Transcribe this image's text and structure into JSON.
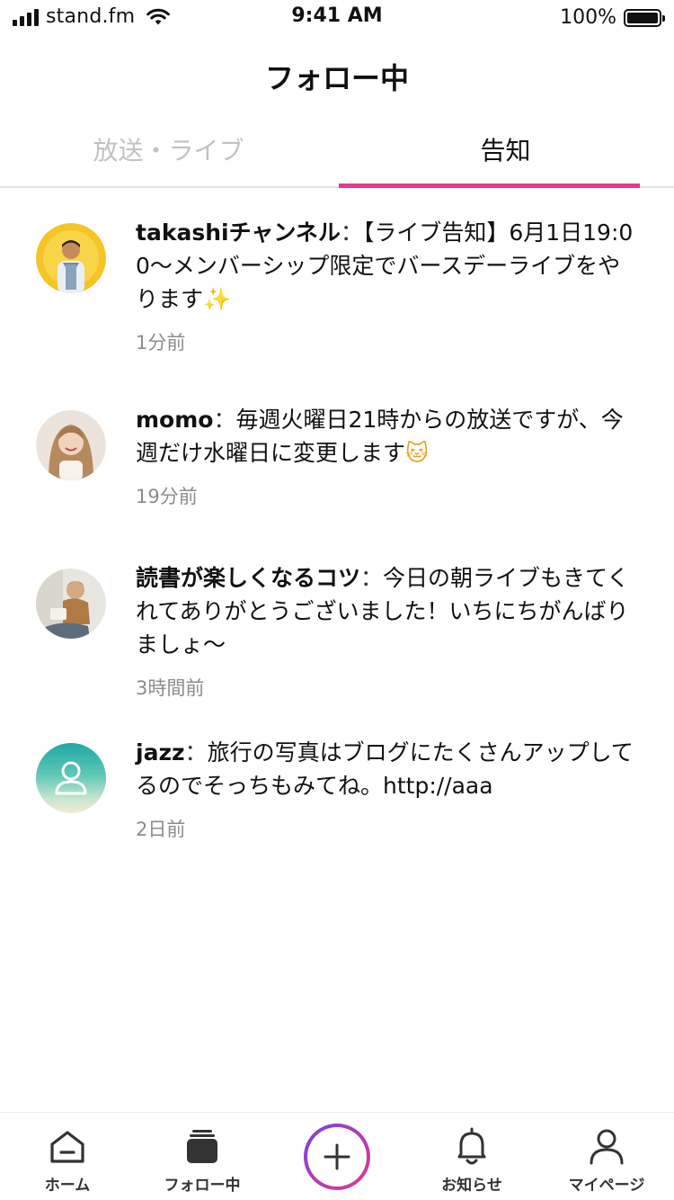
{
  "status_bar": {
    "carrier": "stand.fm",
    "time": "9:41 AM",
    "battery": "100%"
  },
  "header": {
    "title": "フォロー中"
  },
  "tabs": [
    {
      "label": "放送・ライブ",
      "active": false
    },
    {
      "label": "告知",
      "active": true
    }
  ],
  "feed": [
    {
      "name": "takashiチャンネル",
      "separator": "：",
      "message": "【ライブ告知】6月1日19:00〜メンバーシップ限定でバースデーライブをやります",
      "emoji": "✨",
      "time": "1分前"
    },
    {
      "name": "momo",
      "separator": "：",
      "message": "毎週火曜日21時からの放送ですが、今週だけ水曜日に変更します",
      "emoji": "🐱",
      "time": "19分前"
    },
    {
      "name": "読書が楽しくなるコツ",
      "separator": "：",
      "message": "今日の朝ライブもきてくれてありがとうございました！いちにちがんばりましょ〜",
      "emoji": "",
      "time": "3時間前"
    },
    {
      "name": "jazz",
      "separator": "：",
      "message": "旅行の写真はブログにたくさんアップしてるのでそっちもみてね。http://aaa",
      "emoji": "",
      "time": "2日前"
    }
  ],
  "bottom_nav": [
    {
      "label": "ホーム",
      "icon": "home-icon"
    },
    {
      "label": "フォロー中",
      "icon": "stack-icon"
    },
    {
      "label": "",
      "icon": "plus-icon"
    },
    {
      "label": "お知らせ",
      "icon": "bell-icon"
    },
    {
      "label": "マイページ",
      "icon": "person-icon"
    }
  ],
  "colors": {
    "accent": "#e6398c",
    "post_gradient_start": "#7b3fe4",
    "post_gradient_end": "#e6398c",
    "inactive_tab": "#c2c2c2",
    "timestamp": "#8c8c8c"
  }
}
